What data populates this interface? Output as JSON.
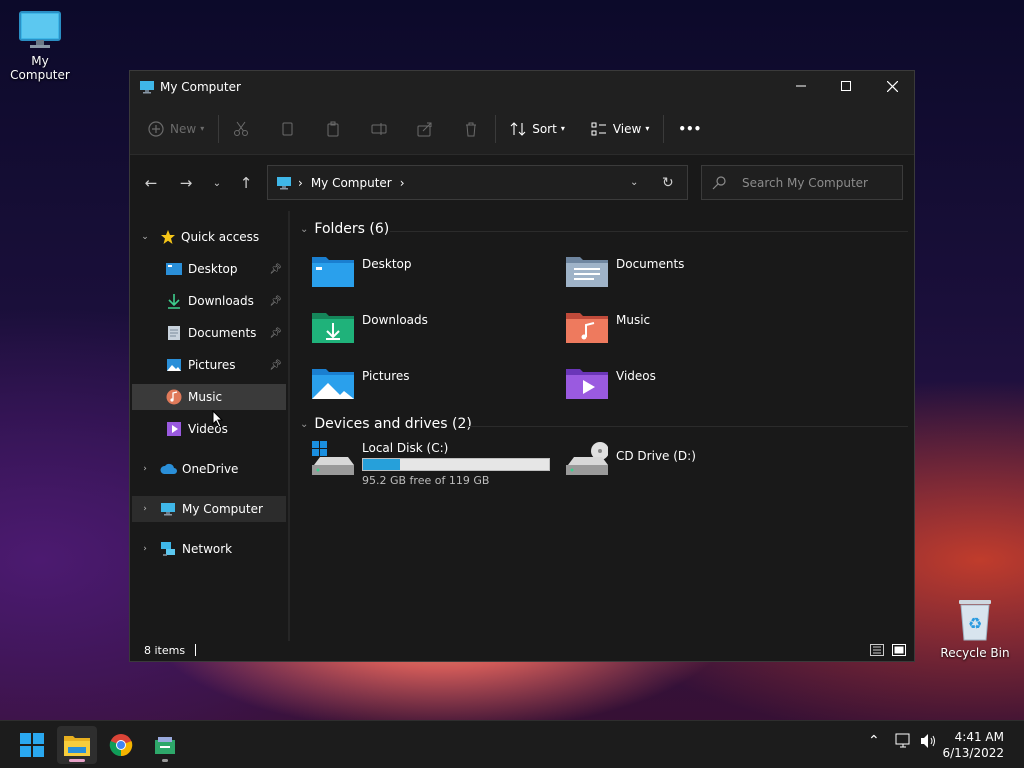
{
  "desktop": {
    "icons": [
      {
        "label": "My Computer",
        "icon": "monitor-icon"
      },
      {
        "label": "Recycle Bin",
        "icon": "recycle-bin-icon"
      }
    ]
  },
  "window": {
    "title": "My Computer",
    "toolbar": {
      "new_label": "New",
      "sort_label": "Sort",
      "view_label": "View",
      "more_label": "•••"
    },
    "address": {
      "crumb": "My Computer",
      "separator": "›"
    },
    "search": {
      "placeholder": "Search My Computer"
    },
    "sidebar": {
      "quick_access": "Quick access",
      "items": [
        {
          "label": "Desktop",
          "icon": "desktop-folder-icon",
          "pinned": true
        },
        {
          "label": "Downloads",
          "icon": "download-icon",
          "pinned": true
        },
        {
          "label": "Documents",
          "icon": "documents-icon",
          "pinned": true
        },
        {
          "label": "Pictures",
          "icon": "pictures-icon",
          "pinned": true
        },
        {
          "label": "Music",
          "icon": "music-icon",
          "pinned": false,
          "selected": true
        },
        {
          "label": "Videos",
          "icon": "videos-icon",
          "pinned": false
        }
      ],
      "onedrive": "OneDrive",
      "my_computer": "My Computer",
      "network": "Network"
    },
    "content": {
      "folders_header": "Folders (6)",
      "folders": [
        {
          "label": "Desktop",
          "icon": "desktop-folder-icon",
          "color": "#1f8fe0"
        },
        {
          "label": "Documents",
          "icon": "documents-folder-icon",
          "color": "#8aa2bd"
        },
        {
          "label": "Downloads",
          "icon": "downloads-folder-icon",
          "color": "#1ea672"
        },
        {
          "label": "Music",
          "icon": "music-folder-icon",
          "color": "#e06a4a"
        },
        {
          "label": "Pictures",
          "icon": "pictures-folder-icon",
          "color": "#1f8fe0"
        },
        {
          "label": "Videos",
          "icon": "videos-folder-icon",
          "color": "#8a4fd8"
        }
      ],
      "drives_header": "Devices and drives (2)",
      "drives": [
        {
          "label": "Local Disk (C:)",
          "free_text": "95.2 GB free of 119 GB",
          "used_fraction": 0.2,
          "icon": "hard-disk-icon"
        },
        {
          "label": "CD Drive (D:)",
          "icon": "cd-drive-icon"
        }
      ]
    },
    "status": {
      "items": "8 items"
    }
  },
  "taskbar": {
    "apps": [
      {
        "name": "start-button",
        "icon": "windows-logo-icon"
      },
      {
        "name": "file-explorer",
        "icon": "folder-icon",
        "active": true
      },
      {
        "name": "chrome",
        "icon": "chrome-icon"
      },
      {
        "name": "app",
        "icon": "app-icon"
      }
    ],
    "clock": {
      "time": "4:41 AM",
      "date": "6/13/2022"
    }
  },
  "colors": {
    "accent": "#26a0da",
    "pink_indicator": "#e8a2c8"
  }
}
